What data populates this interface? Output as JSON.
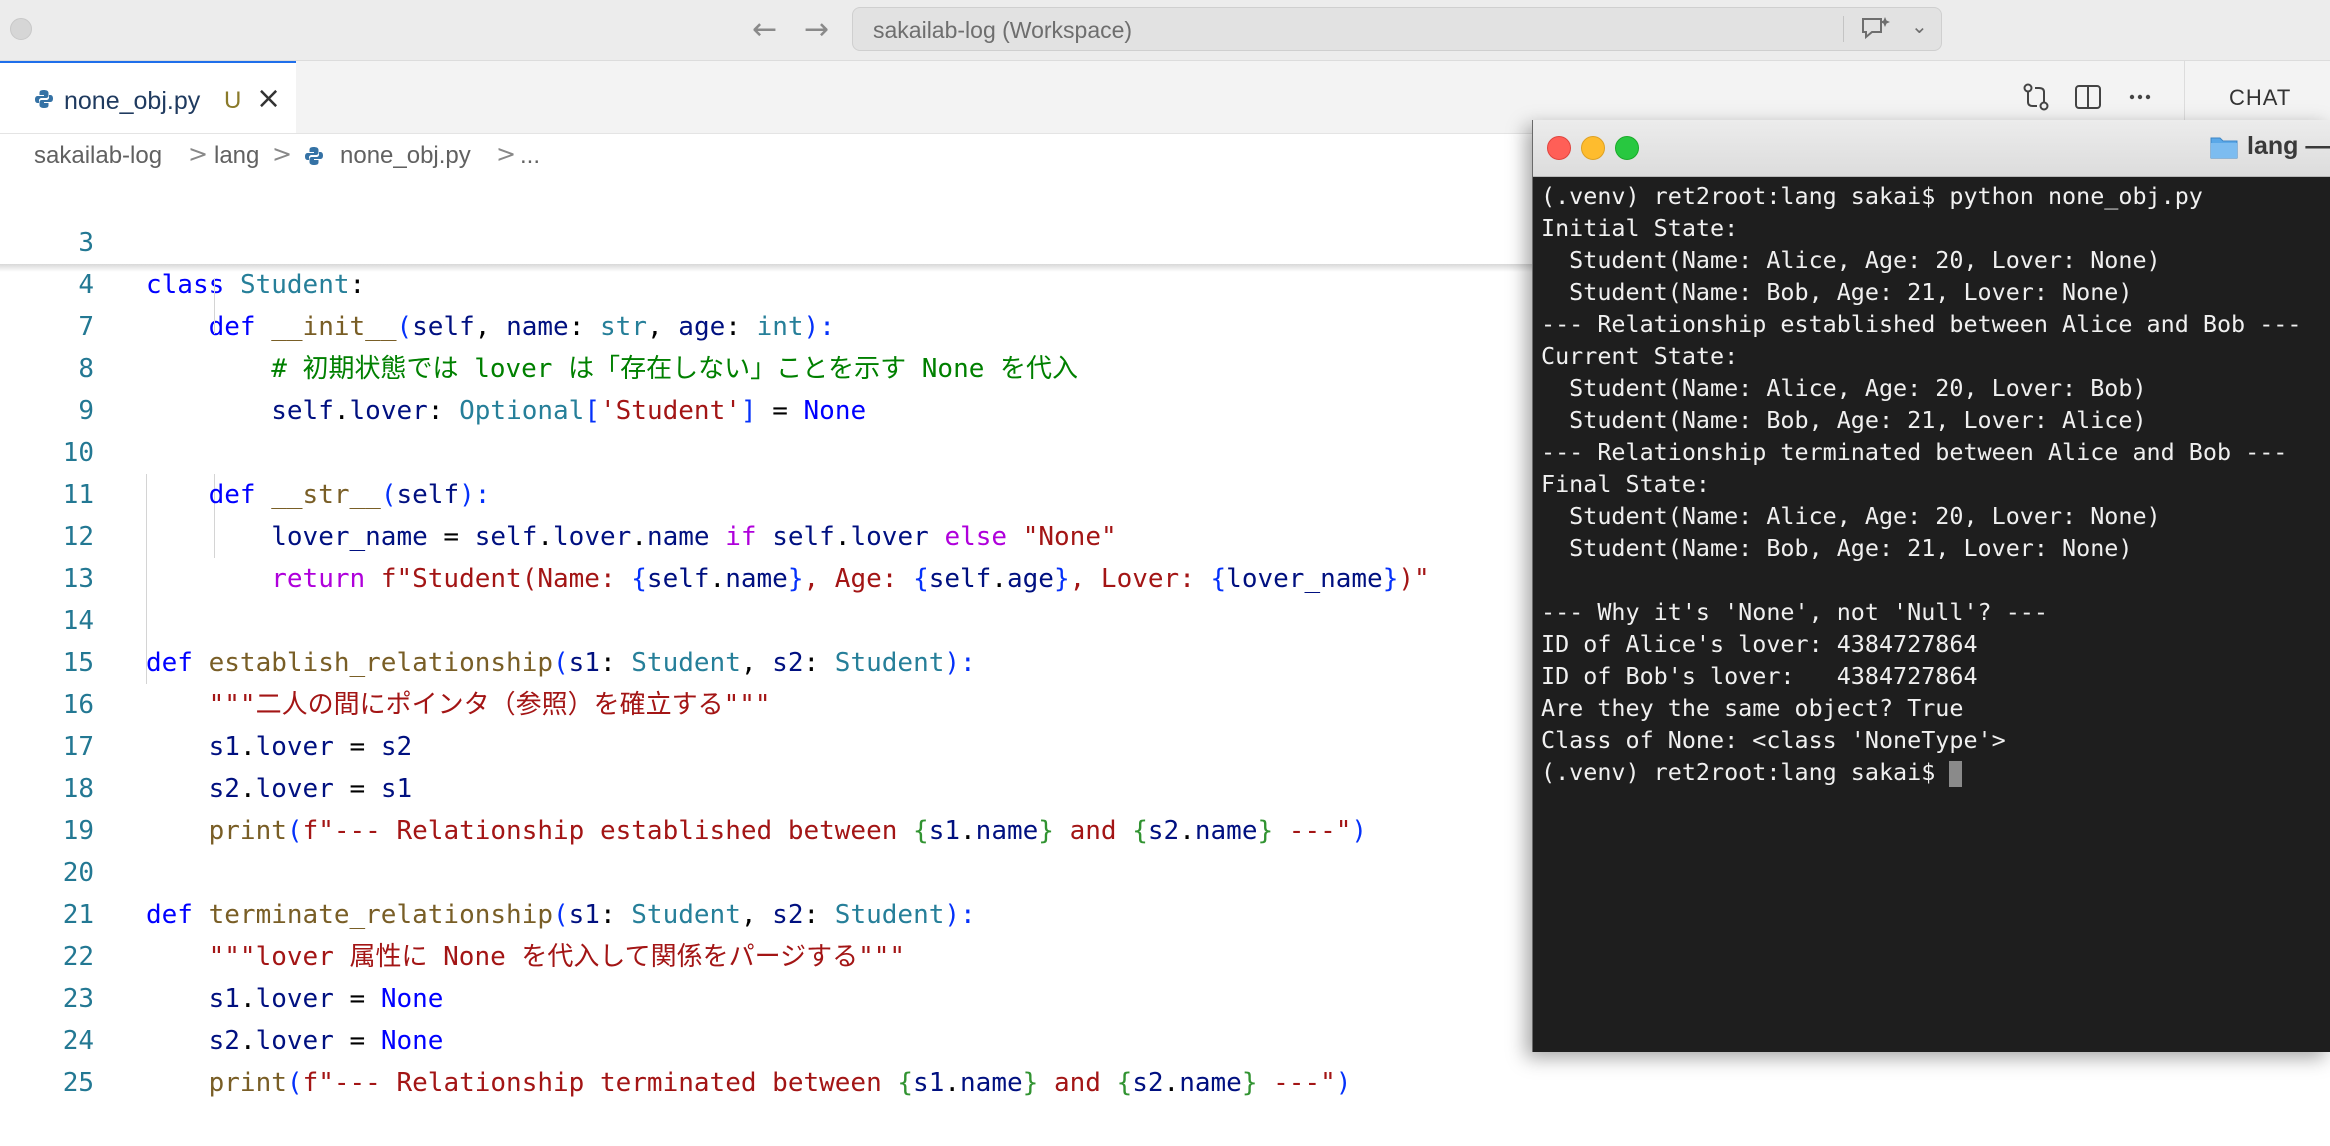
{
  "titlebar": {
    "workspace_title": "sakailab-log (Workspace)",
    "back_icon": "arrow-left-icon",
    "forward_icon": "arrow-right-icon",
    "chat_icon": "chat-sparkle-icon",
    "chevron_icon": "chevron-down-icon"
  },
  "tabs": {
    "active": {
      "label": "none_obj.py",
      "status": "U",
      "close": "×"
    },
    "chat_label": "CHAT"
  },
  "breadcrumb": {
    "items": [
      "sakailab-log",
      "lang",
      "none_obj.py",
      "..."
    ],
    "separator": ">"
  },
  "editor": {
    "line_numbers": [
      "3",
      "4",
      "7",
      "8",
      "9",
      "10",
      "11",
      "12",
      "13",
      "14",
      "15",
      "16",
      "17",
      "18",
      "19",
      "20",
      "21",
      "22",
      "23",
      "24",
      "25"
    ],
    "tokens": {
      "l3": [
        "class",
        "Student",
        ":"
      ],
      "l4": [
        "def",
        "__init__",
        "(",
        "self",
        ", ",
        "name",
        ": ",
        "str",
        ", ",
        "age",
        ": ",
        "int",
        "):"
      ],
      "l7": [
        "# 初期状態では lover は「存在しない」ことを示す None を代入"
      ],
      "l8": [
        "self",
        ".",
        "lover",
        ": ",
        "Optional",
        "[",
        "'Student'",
        "]",
        " = ",
        "None"
      ],
      "l10": [
        "def",
        "__str__",
        "(",
        "self",
        "):"
      ],
      "l11": [
        "lover_name",
        " = ",
        "self",
        ".",
        "lover",
        ".",
        "name",
        "if",
        "self",
        ".",
        "lover",
        "else",
        "\"None\""
      ],
      "l12": [
        "return",
        "f\"Student(Name: ",
        "{",
        "self",
        ".",
        "name",
        "}",
        ", Age: ",
        "{",
        "self",
        ".",
        "age",
        "}",
        ", Lover: ",
        "{",
        "lover_name",
        "}",
        ")\""
      ],
      "l14": [
        "def",
        "establish_relationship",
        "(",
        "s1",
        ": ",
        "Student",
        ", ",
        "s2",
        ": ",
        "Student",
        "):"
      ],
      "l15": [
        "\"\"\"二人の間にポインタ（参照）を確立する\"\"\""
      ],
      "l16": [
        "s1",
        ".",
        "lover",
        " = ",
        "s2"
      ],
      "l17": [
        "s2",
        ".",
        "lover",
        " = ",
        "s1"
      ],
      "l18": [
        "print",
        "(",
        "f\"--- Relationship established between ",
        "{",
        "s1",
        ".",
        "name",
        "}",
        " and ",
        "{",
        "s2",
        ".",
        "name",
        "}",
        " ---\"",
        ")"
      ],
      "l20": [
        "def",
        "terminate_relationship",
        "(",
        "s1",
        ": ",
        "Student",
        ", ",
        "s2",
        ": ",
        "Student",
        "):"
      ],
      "l21": [
        "\"\"\"lover 属性に None を代入して関係をパージする\"\"\""
      ],
      "l22": [
        "s1",
        ".",
        "lover",
        " = ",
        "None"
      ],
      "l23": [
        "s2",
        ".",
        "lover",
        " = ",
        "None"
      ],
      "l24": [
        "print",
        "(",
        "f\"--- Relationship terminated between ",
        "{",
        "s1",
        ".",
        "name",
        "}",
        " and ",
        "{",
        "s2",
        ".",
        "name",
        "}",
        " ---\"",
        ")"
      ]
    }
  },
  "terminal": {
    "title": "lang —",
    "lines": [
      "(.venv) ret2root:lang sakai$ python none_obj.py",
      "Initial State:",
      "  Student(Name: Alice, Age: 20, Lover: None)",
      "  Student(Name: Bob, Age: 21, Lover: None)",
      "--- Relationship established between Alice and Bob ---",
      "Current State:",
      "  Student(Name: Alice, Age: 20, Lover: Bob)",
      "  Student(Name: Bob, Age: 21, Lover: Alice)",
      "--- Relationship terminated between Alice and Bob ---",
      "Final State:",
      "  Student(Name: Alice, Age: 20, Lover: None)",
      "  Student(Name: Bob, Age: 21, Lover: None)",
      "",
      "--- Why it's 'None', not 'Null'? ---",
      "ID of Alice's lover: 4384727864",
      "ID of Bob's lover:   4384727864",
      "Are they the same object? True",
      "Class of None: <class 'NoneType'>"
    ],
    "prompt": "(.venv) ret2root:lang sakai$ "
  },
  "colors": {
    "keyword": "#0000ff",
    "control_keyword": "#af00db",
    "type": "#267f99",
    "function": "#795e26",
    "string": "#a31515",
    "comment": "#008000",
    "variable": "#001080",
    "terminal_bg": "#1e1e1e"
  }
}
